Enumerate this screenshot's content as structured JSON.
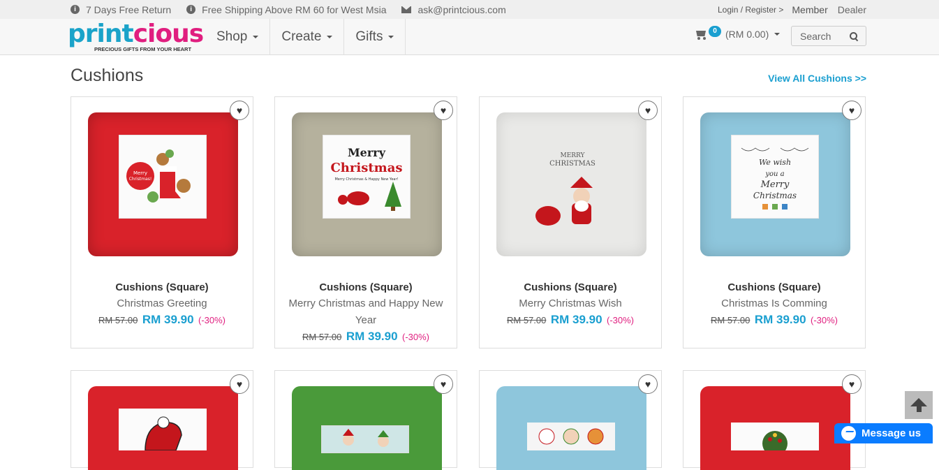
{
  "topbar": {
    "returns": "7 Days Free Return",
    "shipping": "Free Shipping Above RM 60 for West Msia",
    "email": "ask@printcious.com",
    "login": "Login / Register >",
    "member": "Member",
    "dealer": "Dealer"
  },
  "nav": {
    "logo_word_a": "print",
    "logo_word_b": "cious",
    "logo_tagline": "PRECIOUS GIFTS FROM YOUR HEART",
    "menu": [
      "Shop",
      "Create",
      "Gifts"
    ],
    "cart_count": "0",
    "cart_total": "(RM 0.00)",
    "search_label": "Search"
  },
  "section": {
    "title": "Cushions",
    "view_all": "View All Cushions >>"
  },
  "products": [
    {
      "type": "Cushions (Square)",
      "name": "Christmas Greeting",
      "old_price": "RM 57.00",
      "price": "RM 39.90",
      "discount": "(-30%)",
      "color": "#d9222a",
      "panel_text": "Merry Christmas!"
    },
    {
      "type": "Cushions (Square)",
      "name": "Merry Christmas and Happy New Year",
      "old_price": "RM 57.00",
      "price": "RM 39.90",
      "discount": "(-30%)",
      "color": "#b5b19d",
      "panel_text": "Merry Christmas"
    },
    {
      "type": "Cushions (Square)",
      "name": "Merry Christmas Wish",
      "old_price": "RM 57.00",
      "price": "RM 39.90",
      "discount": "(-30%)",
      "color": "#e9e9e7",
      "panel_text": "MERRY CHRISTMAS"
    },
    {
      "type": "Cushions (Square)",
      "name": "Christmas Is Comming",
      "old_price": "RM 57.00",
      "price": "RM 39.90",
      "discount": "(-30%)",
      "color": "#8ec6dc",
      "panel_text": "We wish you a Merry Christmas"
    }
  ],
  "products_row2_colors": [
    "#d9222a",
    "#4a9a3a",
    "#8ec6dc",
    "#d9222a"
  ],
  "widgets": {
    "messenger": "Message us"
  }
}
